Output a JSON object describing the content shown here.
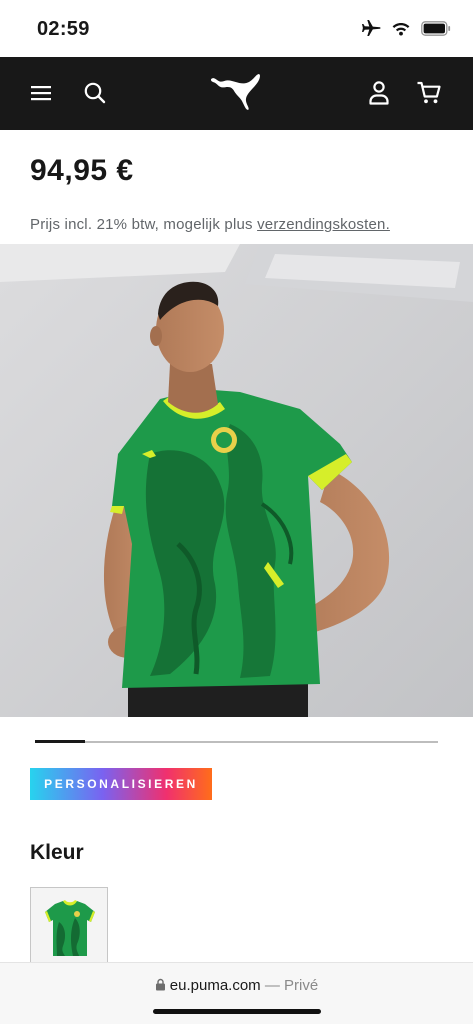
{
  "status": {
    "time": "02:59"
  },
  "product": {
    "price": "94,95 €",
    "price_note": "Prijs incl. 21% btw, mogelijk plus",
    "shipping_link": "verzendingskosten.",
    "gallery_progress": 0.125
  },
  "actions": {
    "personalize": "PERSONALISIEREN"
  },
  "colors_section": {
    "heading": "Kleur"
  },
  "browser": {
    "domain": "eu.puma.com",
    "separator": "—",
    "privacy": "Privé"
  },
  "icons": [
    "airplane-icon",
    "wifi-icon",
    "battery-icon",
    "menu-icon",
    "search-icon",
    "puma-logo",
    "account-icon",
    "cart-icon",
    "lock-icon"
  ],
  "theme": {
    "nav_background": "#181818",
    "jersey_green": "#1e9a4a",
    "jersey_accent": "#d6ee2a"
  }
}
